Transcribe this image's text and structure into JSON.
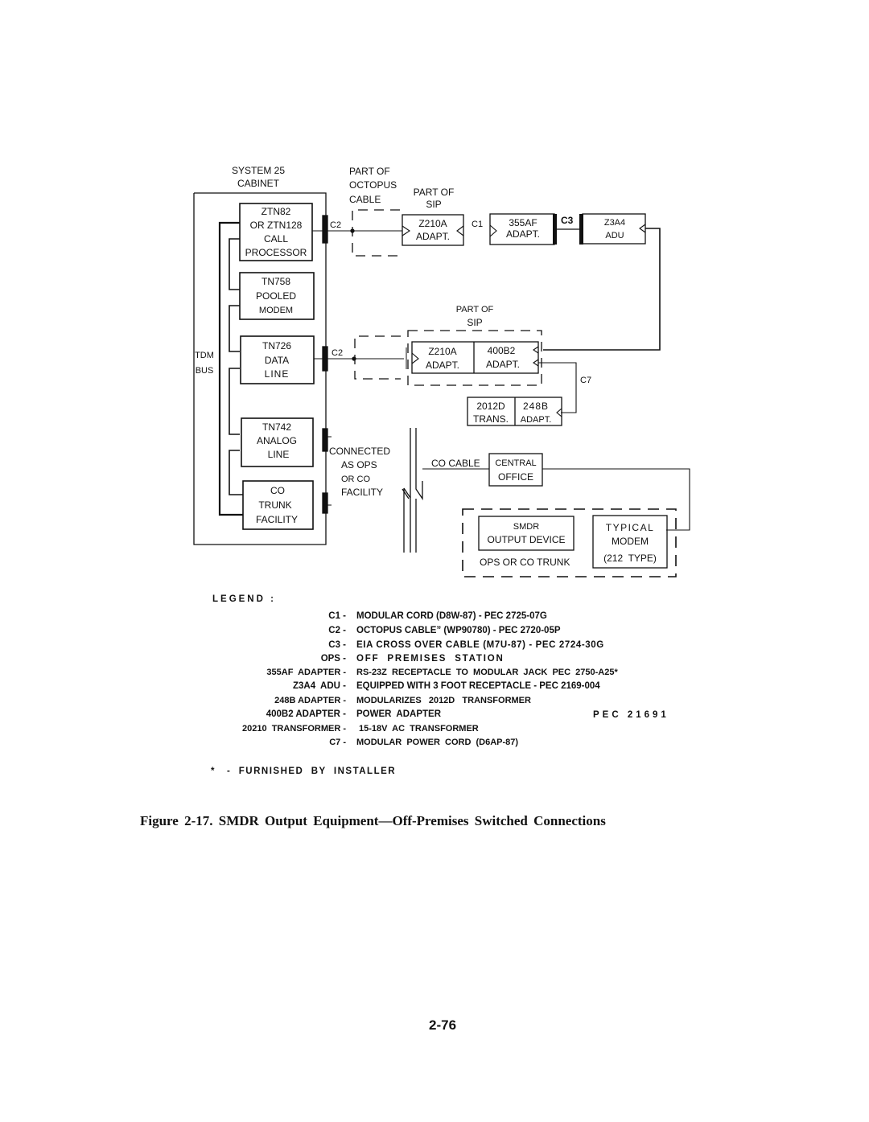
{
  "diagram": {
    "cabinet": {
      "title_line1": "SYSTEM 25",
      "title_line2": "CABINET"
    },
    "tdm_bus": {
      "line1": "TDM",
      "line2": "BUS"
    },
    "boards": [
      {
        "lines": [
          "ZTN82",
          "OR ZTN128",
          "CALL",
          "PROCESSOR"
        ]
      },
      {
        "lines": [
          "TN758",
          "POOLED",
          "MODEM"
        ]
      },
      {
        "lines": [
          "TN726",
          "DATA",
          "LINE"
        ]
      },
      {
        "lines": [
          "TN742",
          "ANALOG",
          "LINE"
        ]
      },
      {
        "lines": [
          "CO",
          "TRUNK",
          "FACILITY"
        ]
      }
    ],
    "octopus_label": [
      "PART OF",
      "OCTOPUS",
      "CABLE"
    ],
    "sip_label_top": [
      "PART OF",
      "SIP"
    ],
    "sip_label_mid": [
      "PART OF",
      "SIP"
    ],
    "connectors": {
      "c2_top": "C2",
      "c2_mid": "C2",
      "c1": "C1",
      "c3": "C3",
      "c7": "C7"
    },
    "z210a_top": [
      "Z210A",
      "ADAPT."
    ],
    "adapter_355af": [
      "355AF",
      "ADAPT."
    ],
    "z3a4": [
      "Z3A4",
      "ADU"
    ],
    "z210a_mid": [
      "Z210A",
      "ADAPT."
    ],
    "adapter_400b2": [
      "400B2",
      "ADAPT."
    ],
    "trans_2012d": [
      "2012D",
      "TRANS."
    ],
    "adapter_248b": [
      "248B",
      "ADAPT."
    ],
    "connected_label": [
      "CONNECTED",
      "AS OPS",
      "OR CO",
      "FACILITY"
    ],
    "co_cable": "CO CABLE",
    "central_office": [
      "CENTRAL",
      "OFFICE"
    ],
    "smdr_device": [
      "SMDR",
      "OUTPUT DEVICE"
    ],
    "ops_or_co_trunk": "OPS OR CO TRUNK",
    "typical_modem": [
      "TYPICAL",
      "MODEM",
      "(212  TYPE)"
    ]
  },
  "legend": {
    "title": "LEGEND :",
    "entries": [
      {
        "key": "C1 -",
        "value": "MODULAR CORD (D8W-87) - PEC 2725-07G"
      },
      {
        "key": "C2 -",
        "value": "OCTOPUS CABLE” (WP90780) - PEC 2720-05P"
      },
      {
        "key": "C3 -",
        "value": "EIA CROSS OVER CABLE (M7U-87) - PEC 2724-30G"
      },
      {
        "key": "OPS -",
        "value": "OFF  PREMISES  STATION"
      },
      {
        "key": "355AF  ADAPTER -",
        "value": "RS-23Z  RECEPTACLE  TO  MODULAR  JACK  PEC  2750-A25*"
      },
      {
        "key": "Z3A4  ADU -",
        "value": "EQUIPPED WITH 3 FOOT RECEPTACLE - PEC 2169-004"
      },
      {
        "key": "248B ADAPTER -",
        "value": "MODULARIZES   2012D   TRANSFORMER"
      },
      {
        "key": "400B2 ADAPTER -",
        "value": "POWER  ADAPTER"
      },
      {
        "key": "20210  TRANSFORMER -",
        "value": "15-18V  AC  TRANSFORMER"
      },
      {
        "key": "C7 -",
        "value": "MODULAR  POWER  CORD  (D6AP-87)"
      }
    ],
    "pec_group": "PEC 21691",
    "footnote": "*   -  FURNISHED  BY  INSTALLER"
  },
  "caption": "Figure 2-17. SMDR Output Equipment—Off-Premises Switched Connections",
  "page_number": "2-76"
}
